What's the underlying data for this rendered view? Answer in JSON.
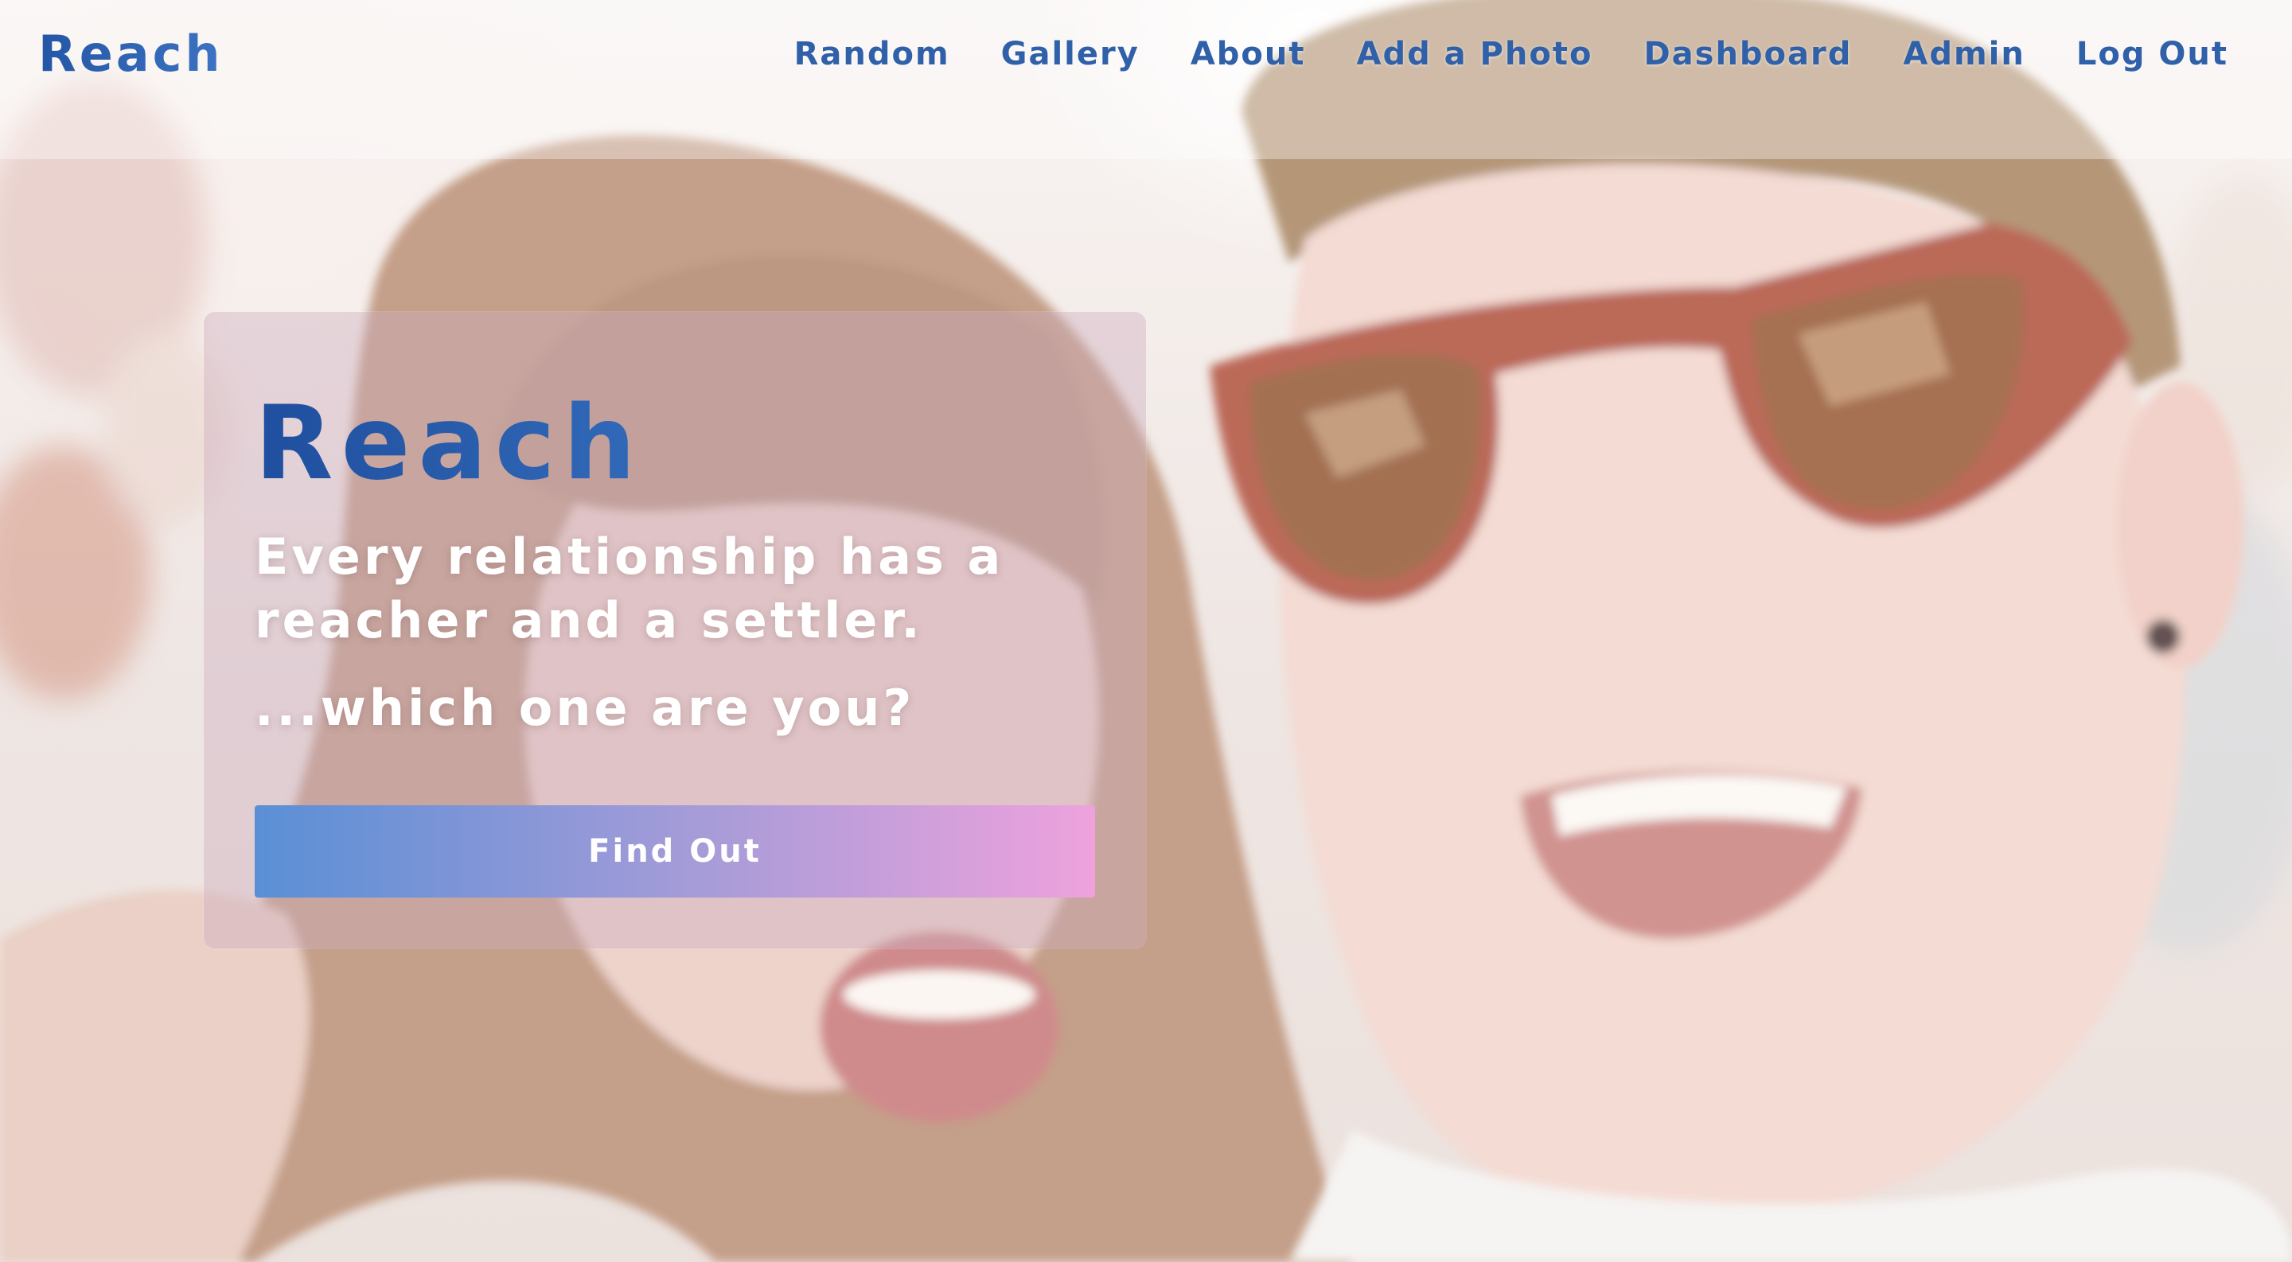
{
  "navbar": {
    "brand": "Reach",
    "links": [
      {
        "label": "Random"
      },
      {
        "label": "Gallery"
      },
      {
        "label": "About"
      },
      {
        "label": "Add a Photo"
      },
      {
        "label": "Dashboard"
      },
      {
        "label": "Admin"
      },
      {
        "label": "Log Out"
      }
    ]
  },
  "hero": {
    "title": "Reach",
    "tagline": "Every relationship has a reacher and a settler.",
    "question": "...which one are you?",
    "button_label": "Find Out"
  },
  "colors": {
    "brand_blue": "#2456a6",
    "nav_blue": "#2f60a8",
    "button_gradient_start": "#5a8fd6",
    "button_gradient_end": "#eea2dd",
    "card_tint": "#cdafbe"
  },
  "background": {
    "description_icon": "couple-photo-background"
  }
}
